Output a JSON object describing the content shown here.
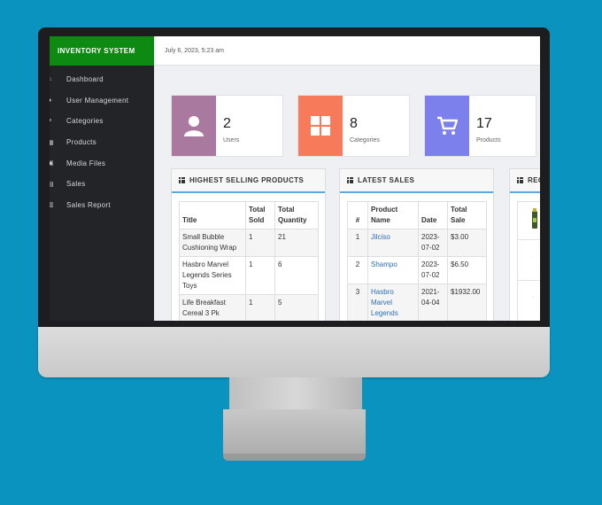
{
  "brand": "INVENTORY SYSTEM",
  "header": {
    "datetime": "July 6, 2023, 5:23 am"
  },
  "sidebar": {
    "items": [
      {
        "label": "Dashboard",
        "icon": "home-icon"
      },
      {
        "label": "User Management",
        "icon": "user-icon"
      },
      {
        "label": "Categories",
        "icon": "categories-icon"
      },
      {
        "label": "Products",
        "icon": "products-icon"
      },
      {
        "label": "Media Files",
        "icon": "media-icon"
      },
      {
        "label": "Sales",
        "icon": "sales-icon"
      },
      {
        "label": "Sales Report",
        "icon": "report-icon"
      }
    ]
  },
  "stats": {
    "users": {
      "count": "2",
      "label": "Users",
      "color": "#a9799f",
      "icon": "user-icon"
    },
    "categories": {
      "count": "8",
      "label": "Categories",
      "color": "#f77b5a",
      "icon": "grid-icon"
    },
    "products": {
      "count": "17",
      "label": "Products",
      "color": "#7b80ec",
      "icon": "cart-icon"
    }
  },
  "highest_selling": {
    "title": "HIGHEST SELLING PRODUCTS",
    "headers": [
      "Title",
      "Total Sold",
      "Total Quantity"
    ],
    "rows": [
      [
        "Small Bubble Cushioning Wrap",
        "1",
        "21"
      ],
      [
        "Hasbro Marvel Legends Series Toys",
        "1",
        "6"
      ],
      [
        "Life Breakfast Cereal 3 Pk",
        "1",
        "5"
      ]
    ]
  },
  "latest_sales": {
    "title": "LATEST SALES",
    "headers": [
      "#",
      "Product Name",
      "Date",
      "Total Sale"
    ],
    "rows": [
      [
        "1",
        "Jilciso",
        "2023-07-02",
        "$3.00"
      ],
      [
        "2",
        "Shampo",
        "2023-07-02",
        "$6.50"
      ],
      [
        "3",
        "Hasbro Marvel Legends Series Toys",
        "2021-04-04",
        "$1932.00"
      ]
    ]
  },
  "recent": {
    "title": "REC"
  }
}
